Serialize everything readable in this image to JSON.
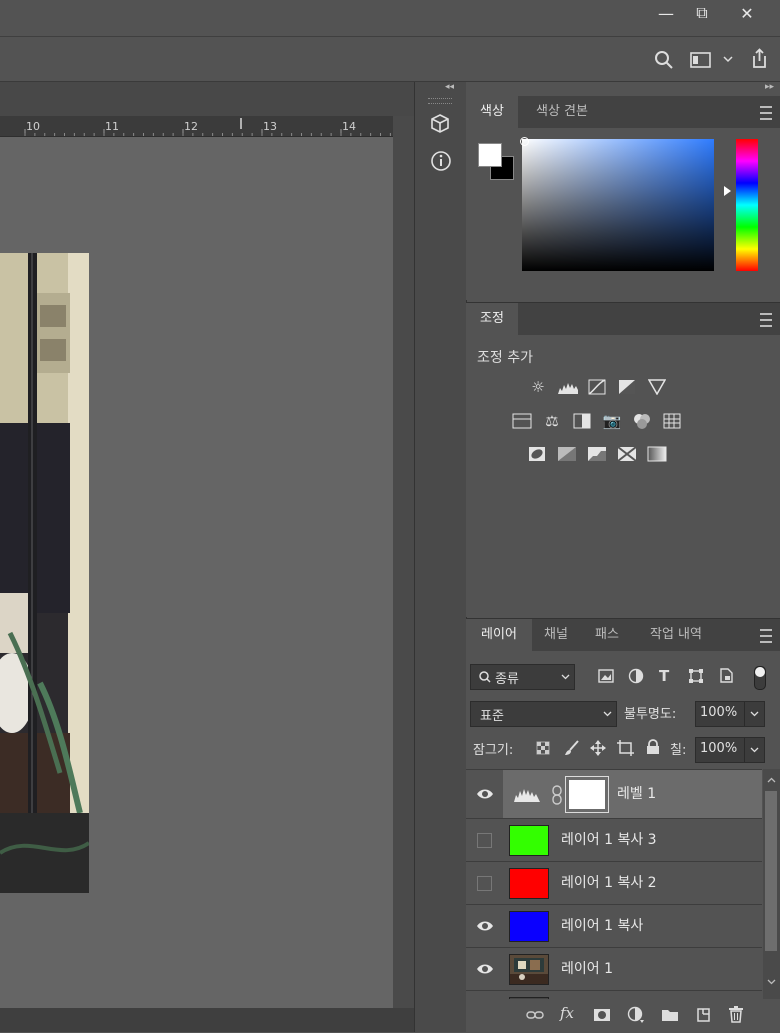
{
  "window": {
    "minimize": "—",
    "restore": "⧉",
    "close": "✕"
  },
  "ruler": {
    "ticks": [
      "10",
      "11",
      "12",
      "13",
      "14"
    ]
  },
  "color_panel": {
    "tabs": [
      "색상",
      "색상 견본"
    ],
    "colors": {
      "foreground": "#ffffff",
      "background": "#000000"
    }
  },
  "adjust_panel": {
    "tab": "조정",
    "heading": "조정 추가"
  },
  "layers_panel": {
    "tabs": [
      "레이어",
      "채널",
      "패스",
      "작업 내역"
    ],
    "filter_label": "종류",
    "blend_mode": "표준",
    "opacity_label": "불투명도:",
    "opacity_value": "100%",
    "lock_label": "잠그기:",
    "fill_label": "칠:",
    "fill_value": "100%",
    "layers": [
      {
        "name": "레벨 1",
        "visible": true,
        "selected": true,
        "thumb": "#ffffff"
      },
      {
        "name": "레이어 1 복사 3",
        "visible": false,
        "thumb": "#33ff00"
      },
      {
        "name": "레이어 1 복사 2",
        "visible": false,
        "thumb": "#ff0000"
      },
      {
        "name": "레이어 1 복사",
        "visible": true,
        "thumb": "#0a00ff"
      },
      {
        "name": "레이어 1",
        "visible": true,
        "thumb": "photo"
      }
    ],
    "footer_fx": "fx"
  }
}
